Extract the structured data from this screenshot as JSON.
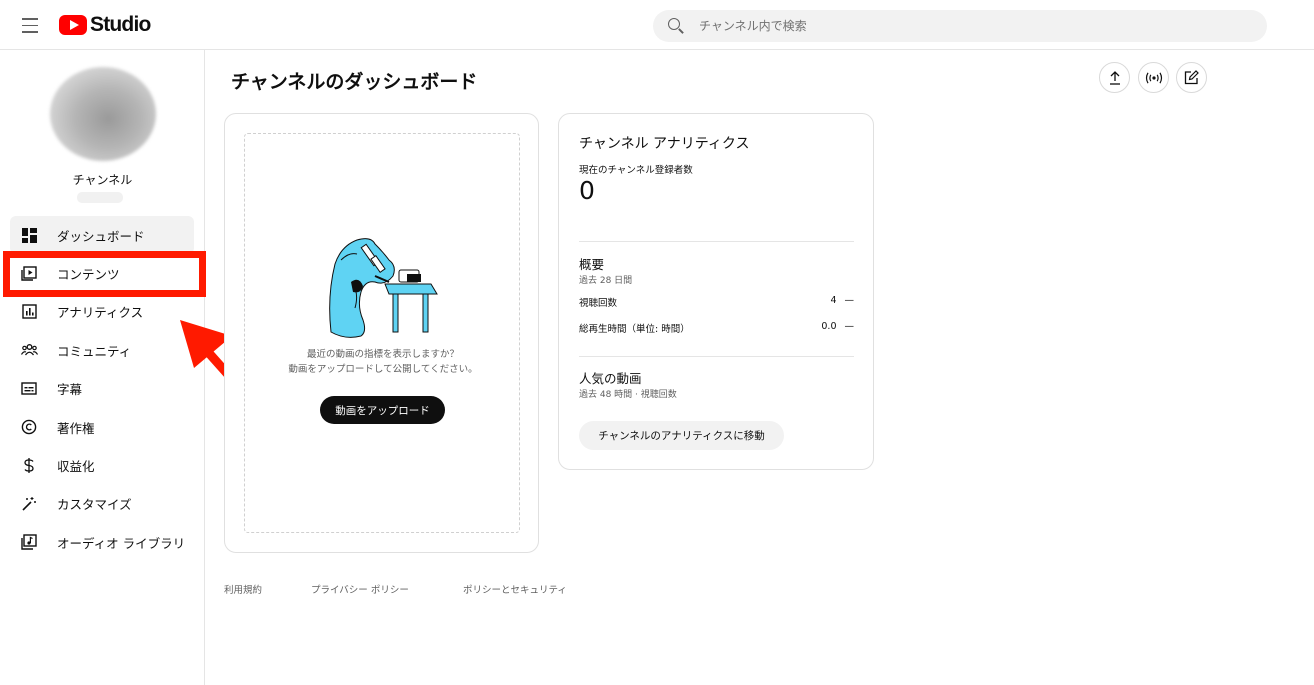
{
  "header": {
    "logo_text": "Studio",
    "search_placeholder": "チャンネル内で検索"
  },
  "sidebar": {
    "channel_name": "チャンネル",
    "items": [
      {
        "label": "ダッシュボード",
        "icon": "dashboard-icon",
        "active": true
      },
      {
        "label": "コンテンツ",
        "icon": "content-icon"
      },
      {
        "label": "アナリティクス",
        "icon": "analytics-icon"
      },
      {
        "label": "コミュニティ",
        "icon": "community-icon"
      },
      {
        "label": "字幕",
        "icon": "subtitles-icon"
      },
      {
        "label": "著作権",
        "icon": "copyright-icon"
      },
      {
        "label": "収益化",
        "icon": "dollar-icon"
      },
      {
        "label": "カスタマイズ",
        "icon": "magic-wand-icon"
      },
      {
        "label": "オーディオ ライブラリ",
        "icon": "audio-library-icon"
      }
    ]
  },
  "main": {
    "title": "チャンネルのダッシュボード",
    "actions": [
      "upload-icon",
      "live-icon",
      "edit-icon"
    ],
    "upload_card": {
      "prompt_line1": "最近の動画の指標を表示しますか？",
      "prompt_line2": "動画をアップロードして公開してください。",
      "button": "動画をアップロード"
    },
    "analytics_card": {
      "title": "チャンネル アナリティクス",
      "subscribers_label": "現在のチャンネル登録者数",
      "subscribers_value": "0",
      "summary_title": "概要",
      "summary_period": "過去 28 日間",
      "metrics": [
        {
          "label": "視聴回数",
          "value": "4",
          "trend": "—"
        },
        {
          "label": "総再生時間（単位: 時間）",
          "value": "0.0",
          "trend": "—"
        }
      ],
      "popular_title": "人気の動画",
      "popular_period": "過去 48 時間 · 視聴回数",
      "goto_button": "チャンネルのアナリティクスに移動"
    }
  },
  "footer": {
    "terms": "利用規約",
    "privacy": "プライバシー ポリシー",
    "policy": "ポリシーとセキュリティ"
  },
  "colors": {
    "highlight": "#ff1a00",
    "brand": "#ff0000",
    "illustration": "#5fd3f3"
  }
}
